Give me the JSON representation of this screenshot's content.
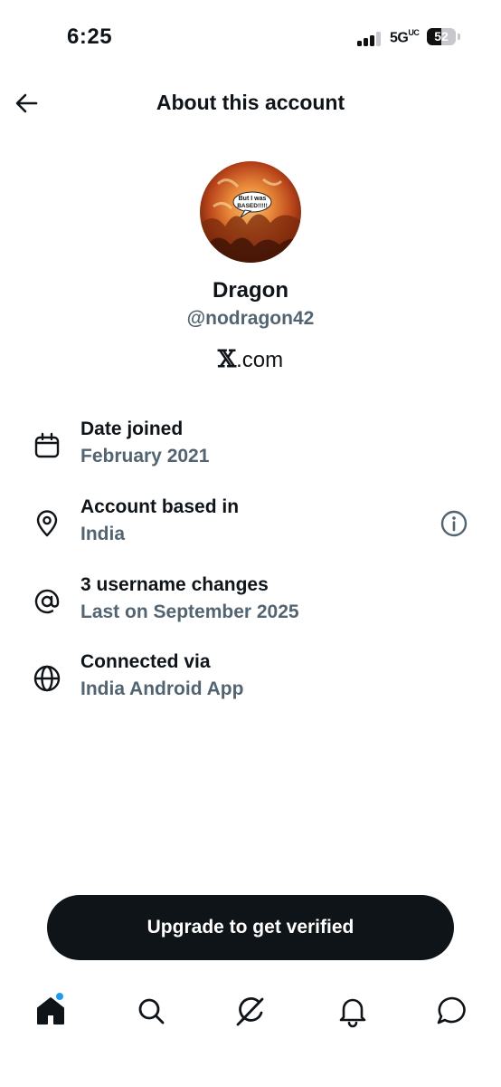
{
  "status_bar": {
    "time": "6:25",
    "network": "5G",
    "network_suffix": "UC",
    "battery_level": "52"
  },
  "header": {
    "title": "About this account"
  },
  "profile": {
    "avatar_caption_line1": "But I was",
    "avatar_caption_line2": "BASED!!!!!",
    "display_name": "Dragon",
    "handle": "@nodragon42",
    "site_logo": "𝕏",
    "site_suffix": ".com"
  },
  "info_rows": [
    {
      "icon": "calendar-icon",
      "title": "Date joined",
      "value": "February 2021"
    },
    {
      "icon": "location-pin-icon",
      "title": "Account based in",
      "value": "India"
    },
    {
      "icon": "at-sign-icon",
      "title": "3 username changes",
      "value": "Last on September 2025"
    },
    {
      "icon": "globe-icon",
      "title": "Connected via",
      "value": "India Android App"
    }
  ],
  "upgrade": {
    "label": "Upgrade to get verified"
  },
  "tab_bar": {
    "tabs": [
      "home-icon",
      "search-icon",
      "grok-icon",
      "notifications-icon",
      "messages-icon"
    ],
    "active": "home-icon"
  },
  "colors": {
    "text": "#0f1419",
    "secondary": "#536471",
    "accent": "#1d9bf0",
    "button_bg": "#0f1419"
  }
}
